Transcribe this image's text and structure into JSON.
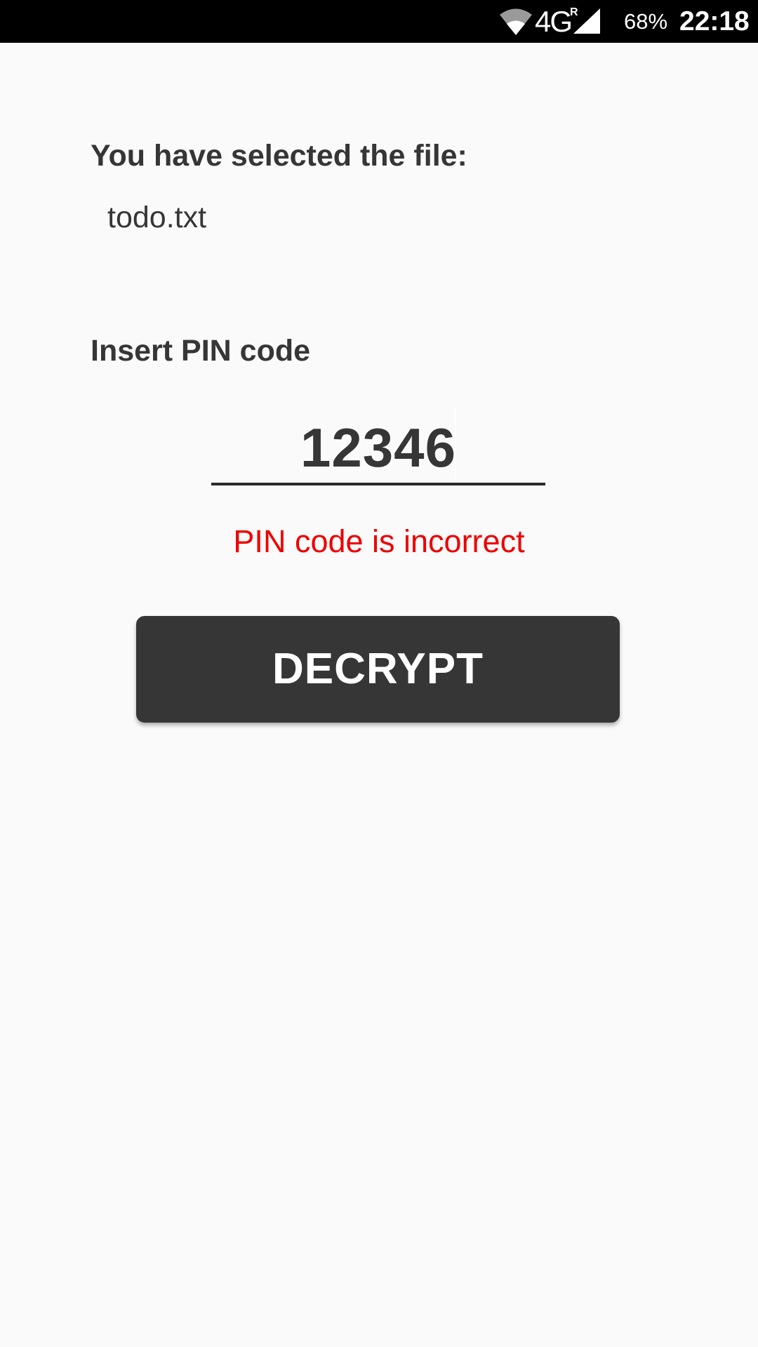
{
  "status_bar": {
    "network_type": "4G",
    "network_sup": "R",
    "battery": "68%",
    "time": "22:18",
    "icons": [
      "wifi-icon",
      "cell-signal-icon"
    ]
  },
  "main": {
    "selected_label": "You have selected the file:",
    "file_name": "todo.txt",
    "pin_label": "Insert PIN code",
    "pin_value": "12346",
    "error_message": "PIN code is incorrect",
    "decrypt_label": "DECRYPT"
  },
  "colors": {
    "background": "#fafafa",
    "text": "#363636",
    "error": "#ee0000",
    "button_bg": "#363636",
    "button_text": "#ffffff",
    "status_bar_bg": "#000000"
  }
}
